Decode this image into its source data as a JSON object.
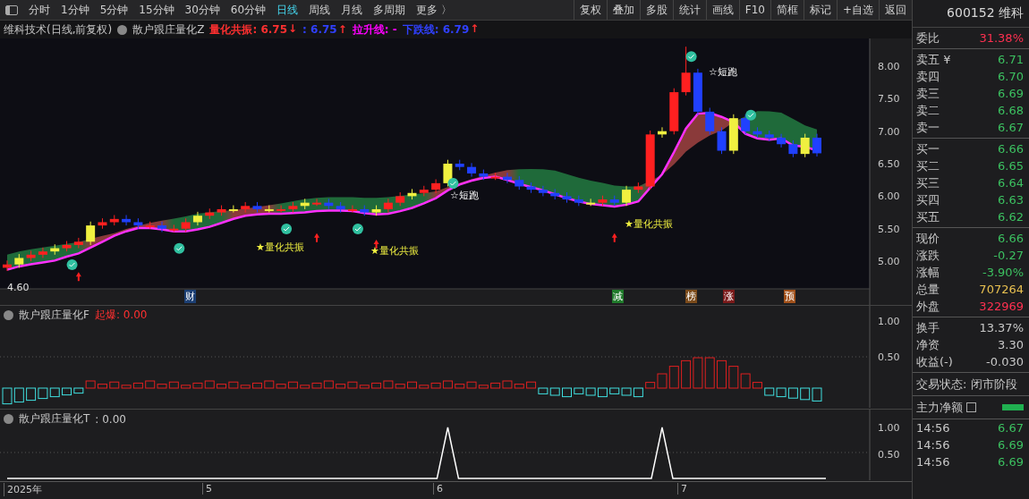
{
  "toolbar": {
    "periods": [
      {
        "label": "分时",
        "selected": false
      },
      {
        "label": "1分钟",
        "selected": false
      },
      {
        "label": "5分钟",
        "selected": false
      },
      {
        "label": "15分钟",
        "selected": false
      },
      {
        "label": "30分钟",
        "selected": false
      },
      {
        "label": "60分钟",
        "selected": false
      },
      {
        "label": "日线",
        "selected": true
      },
      {
        "label": "周线",
        "selected": false
      },
      {
        "label": "月线",
        "selected": false
      },
      {
        "label": "多周期",
        "selected": false
      }
    ],
    "more": "更多 〉",
    "buttons": [
      "复权",
      "叠加",
      "多股",
      "统计",
      "画线",
      "F10",
      "简框",
      "标记",
      "+自选",
      "返回"
    ]
  },
  "main_panel": {
    "title": "维科技术(日线,前复权)",
    "indicator": "散户跟庄量化Z",
    "readings": [
      {
        "text": "量化共振: 6.75",
        "color": "#ff3030",
        "arrow": "↓"
      },
      {
        "text": ": 6.75",
        "color": "#3040ff",
        "arrow": "↑"
      },
      {
        "text": "拉升线: -",
        "color": "#ff00ff"
      },
      {
        "text": "下跌线: 6.79",
        "color": "#3040ff",
        "arrow": "↑"
      }
    ],
    "yticks": [
      "8.00",
      "7.50",
      "7.00",
      "6.50",
      "6.00",
      "5.50",
      "5.00"
    ],
    "low_label": "4.60",
    "annotations": [
      {
        "text": "★量化共振",
        "kind": "signal"
      },
      {
        "text": "★量化共振",
        "kind": "signal"
      },
      {
        "text": "☆短跑",
        "kind": "sprint"
      },
      {
        "text": "★量化共振",
        "kind": "signal"
      },
      {
        "text": "☆短跑",
        "kind": "sprint"
      }
    ],
    "event_tags": [
      {
        "text": "财",
        "color": "#1c3f73"
      },
      {
        "text": "减",
        "color": "#1f7a2a"
      },
      {
        "text": "榜",
        "color": "#7a4a1a"
      },
      {
        "text": "涨",
        "color": "#7a1a1a"
      },
      {
        "text": "预",
        "color": "#a0501a"
      }
    ]
  },
  "panel_f": {
    "indicator": "散户跟庄量化F",
    "reading": "起爆: 0.00",
    "yticks": [
      "1.00",
      "0.50"
    ]
  },
  "panel_t": {
    "indicator": "散户跟庄量化T",
    "reading": ": 0.00",
    "yticks": [
      "1.00",
      "0.50"
    ]
  },
  "x_axis": [
    "2025年",
    "5",
    "6",
    "7"
  ],
  "quote": {
    "code": "600152 维科",
    "weibi": {
      "label": "委比",
      "value": "31.38%",
      "color": "#ff3050"
    },
    "asks": [
      {
        "label": "卖五 ¥",
        "value": "6.71"
      },
      {
        "label": "卖四",
        "value": "6.70"
      },
      {
        "label": "卖三",
        "value": "6.69"
      },
      {
        "label": "卖二",
        "value": "6.68"
      },
      {
        "label": "卖一",
        "value": "6.67"
      }
    ],
    "bids": [
      {
        "label": "买一",
        "value": "6.66"
      },
      {
        "label": "买二",
        "value": "6.65"
      },
      {
        "label": "买三",
        "value": "6.64"
      },
      {
        "label": "买四",
        "value": "6.63"
      },
      {
        "label": "买五",
        "value": "6.62"
      }
    ],
    "stats": [
      {
        "label": "现价",
        "value": "6.66",
        "color": "#3cc060"
      },
      {
        "label": "涨跌",
        "value": "-0.27",
        "color": "#3cc060"
      },
      {
        "label": "涨幅",
        "value": "-3.90%",
        "color": "#3cc060"
      },
      {
        "label": "总量",
        "value": "707264",
        "color": "#e8c050"
      },
      {
        "label": "外盘",
        "value": "322969",
        "color": "#ff3050"
      }
    ],
    "stats2": [
      {
        "label": "换手",
        "value": "13.37%"
      },
      {
        "label": "净资",
        "value": "3.30"
      },
      {
        "label": "收益(-)",
        "value": "-0.030"
      }
    ],
    "status": "交易状态: 闭市阶段",
    "main_net": "主力净额",
    "ticks": [
      {
        "time": "14:56",
        "price": "6.67"
      },
      {
        "time": "14:56",
        "price": "6.69"
      },
      {
        "time": "14:56",
        "price": "6.69"
      }
    ]
  }
}
